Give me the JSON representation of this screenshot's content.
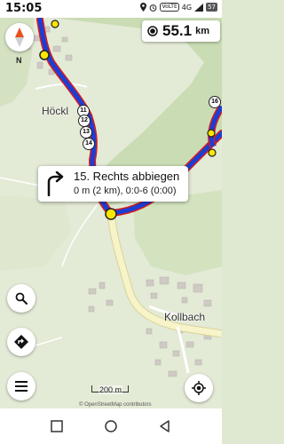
{
  "status_bar": {
    "time": "15:05",
    "network": "4G",
    "network_badge": "VoLTE",
    "battery": "57"
  },
  "map": {
    "north_label": "N",
    "distance": {
      "value": "55.1",
      "unit": "km"
    },
    "instruction": {
      "title": "15. Rechts abbiegen",
      "detail": "0 m (2 km), 0:0-6 (0:00)"
    },
    "places": [
      "Höckl",
      "Kollbach"
    ],
    "waypoints": [
      "11",
      "12",
      "13",
      "14",
      "16"
    ],
    "scale_label": "200 m",
    "attribution": "© OpenStreetMap contributors"
  },
  "colors": {
    "route": "#1b3fd6",
    "route_edge": "#d81b1b",
    "waypoint": "#ffe600",
    "road": "#f6f4c8",
    "grass": "#dfe8d0",
    "forest": "#c9dcb4"
  },
  "icons": {
    "compass": "compass-icon",
    "search": "search-icon",
    "navigate": "navigation-icon",
    "menu": "menu-icon",
    "locate": "my-location-icon",
    "turn": "turn-right-icon"
  }
}
